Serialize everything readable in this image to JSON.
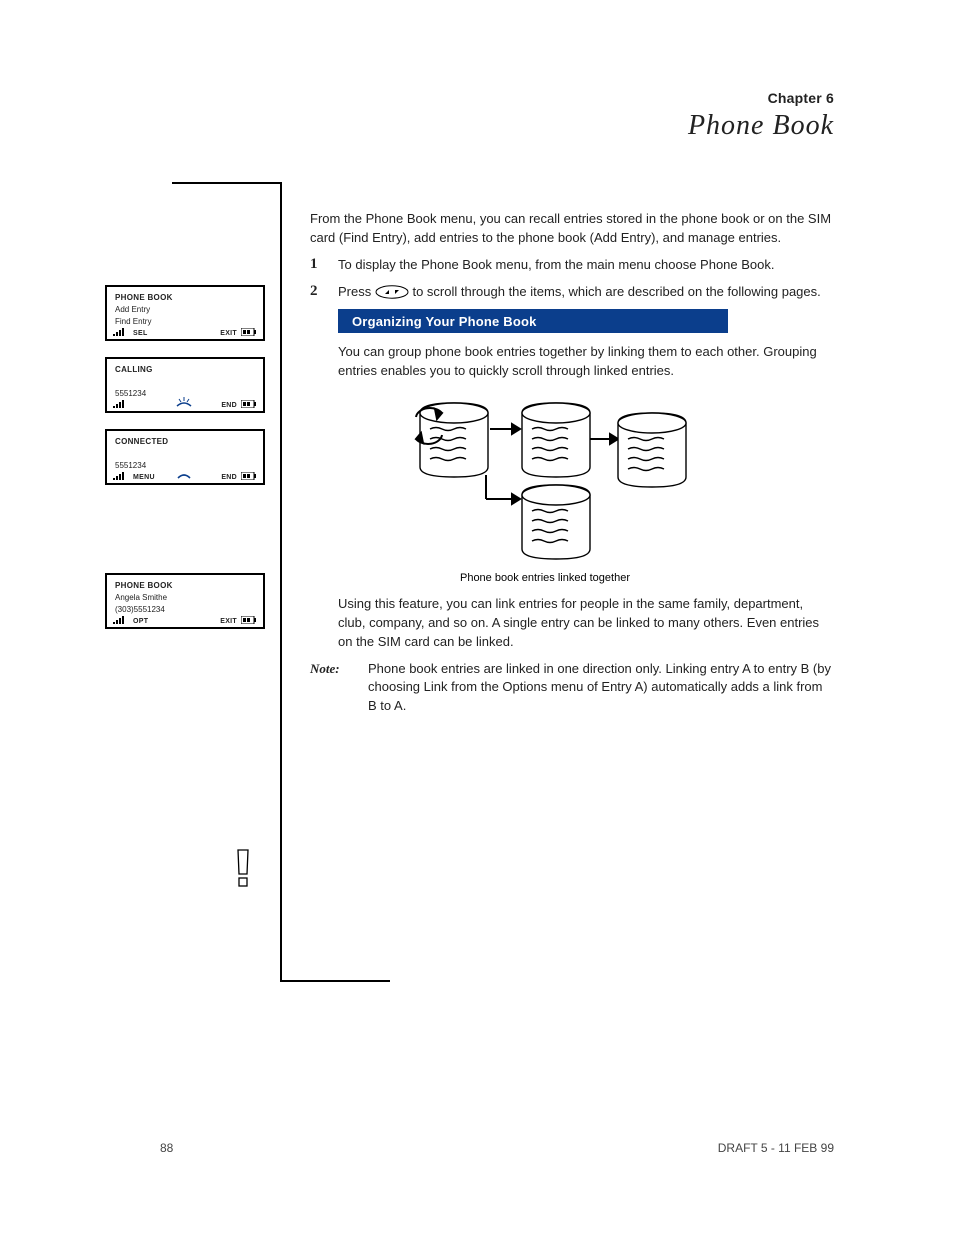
{
  "chapter": {
    "label": "Chapter 6",
    "title": "Phone Book"
  },
  "panels": {
    "0": {
      "line1": "PHONE BOOK",
      "line2": "Add Entry",
      "line3": "Find Entry",
      "sk_left": "SEL",
      "sk_right": "EXIT"
    },
    "1": {
      "line1": "CALLING",
      "line2": "",
      "line3": "5551234",
      "sk_left": "",
      "sk_right": "END"
    },
    "2": {
      "line1": "CONNECTED",
      "line2": "",
      "line3": "5551234",
      "sk_left": "MENU",
      "sk_right": "END"
    },
    "3": {
      "line1": "PHONE BOOK",
      "line2": "Angela Smithe",
      "line3": "(303)5551234",
      "sk_left": "OPT",
      "sk_right": "EXIT"
    }
  },
  "para1": "From the Phone Book menu, you can recall entries stored in the phone book or on the SIM card (Find Entry), add entries to the phone book (Add Entry), and manage entries.",
  "steps": {
    "0": {
      "num": "1",
      "txt": "To display the Phone Book menu, from the main menu choose Phone Book."
    },
    "1": {
      "num": "2",
      "txt_a": "Press ",
      "txt_b": " to scroll through the items, which are described on the following pages."
    }
  },
  "banner": "Organizing Your Phone Book",
  "sub1": "You can group phone book entries together by linking them to each other. Grouping entries enables you to quickly scroll through linked entries.",
  "diagram_caption": "Phone book entries linked together",
  "sub2": "Using this feature, you can link entries for people in the same family, department, club, company, and so on. A single entry can be linked to many others. Even entries on the SIM card can be linked.",
  "note": {
    "label": "Note:",
    "text": "Phone book entries are linked in one direction only. Linking entry A to entry B (by choosing Link from the Options menu of Entry A) automatically adds a link from B to A."
  },
  "footer": {
    "left": "88",
    "right": "DRAFT 5  -  11 FEB 99"
  }
}
